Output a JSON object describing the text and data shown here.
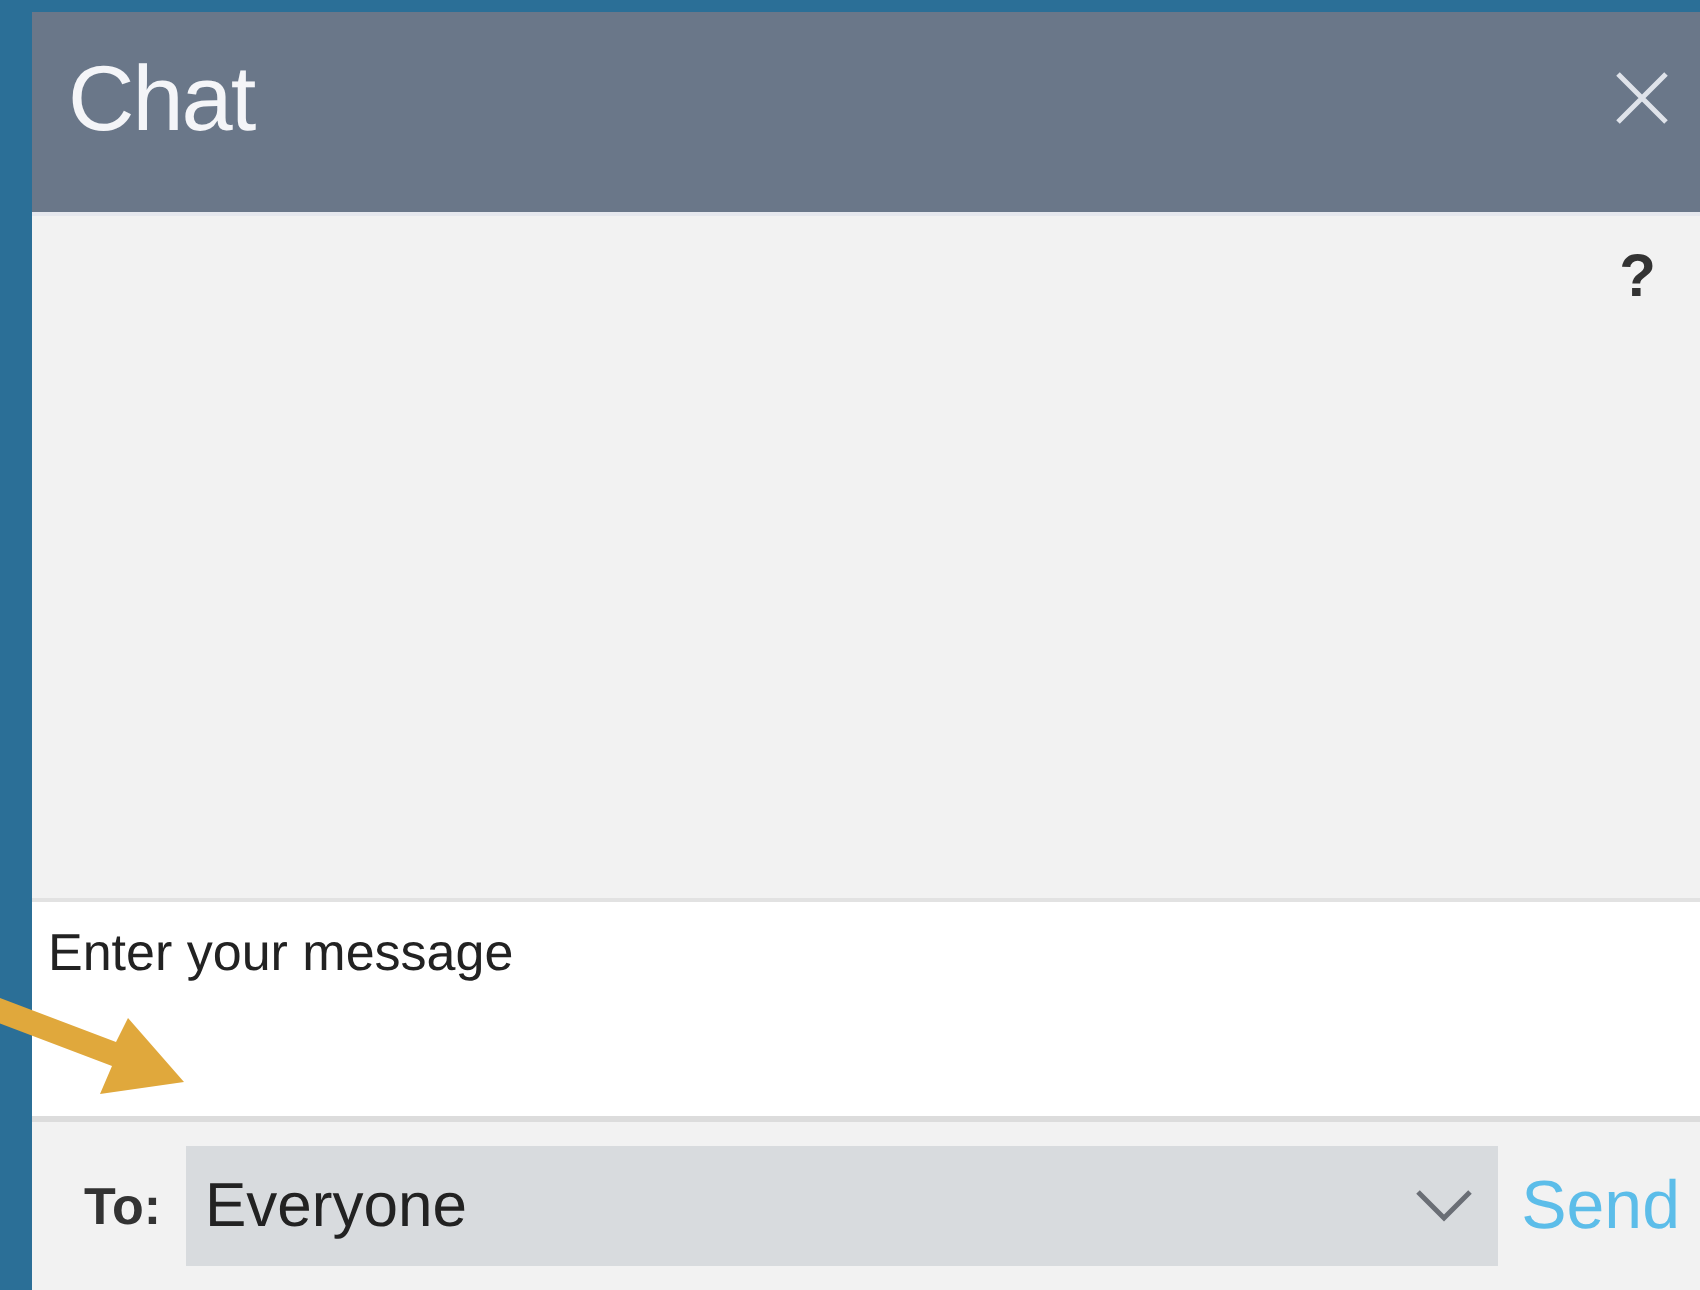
{
  "window": {
    "title": "Chat"
  },
  "help": {
    "label": "?"
  },
  "message": {
    "placeholder": "Enter your message"
  },
  "recipient": {
    "label": "To:",
    "value": "Everyone"
  },
  "send": {
    "label": "Send"
  }
}
